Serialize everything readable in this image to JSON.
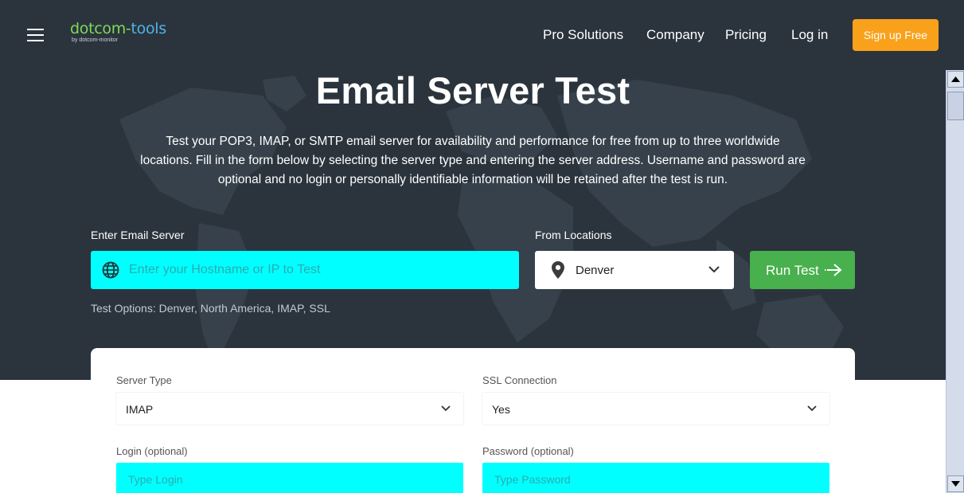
{
  "header": {
    "logo_primary": "dotcom-",
    "logo_secondary": "tools",
    "logo_tagline": "by dotcom-monitor",
    "nav": [
      "Pro Solutions",
      "Company",
      "Pricing",
      "Log in"
    ],
    "signup_label": "Sign up Free"
  },
  "hero": {
    "title": "Email Server Test",
    "intro_lines": [
      "Test your POP3, IMAP, or SMTP email server for availability and performance for free from up to three worldwide",
      "locations. Fill in the form below by selecting the server type and entering the server address. Username and password are",
      "optional and no login or personally identifiable information will be retained after the test is run."
    ],
    "server_label": "Enter Email Server",
    "server_placeholder": "Enter your Hostname or IP to Test",
    "locations_label": "From Locations",
    "location_value": "Denver",
    "run_label": "Run Test",
    "test_options": "Test Options: Denver, North America, IMAP, SSL"
  },
  "options_card": {
    "server_type_label": "Server Type",
    "server_type_value": "IMAP",
    "ssl_label": "SSL Connection",
    "ssl_value": "Yes",
    "login_label": "Login (optional)",
    "login_placeholder": "Type Login",
    "password_label": "Password (optional)",
    "password_placeholder": "Type Password"
  },
  "colors": {
    "header_bg": "#2b343d",
    "accent_orange": "#f9a11b",
    "run_green": "#48b04d",
    "field_cyan": "#00ffff"
  },
  "icons": [
    "menu-icon",
    "globe-icon",
    "map-pin-icon",
    "chevron-down-icon",
    "arrow-right-icon"
  ]
}
